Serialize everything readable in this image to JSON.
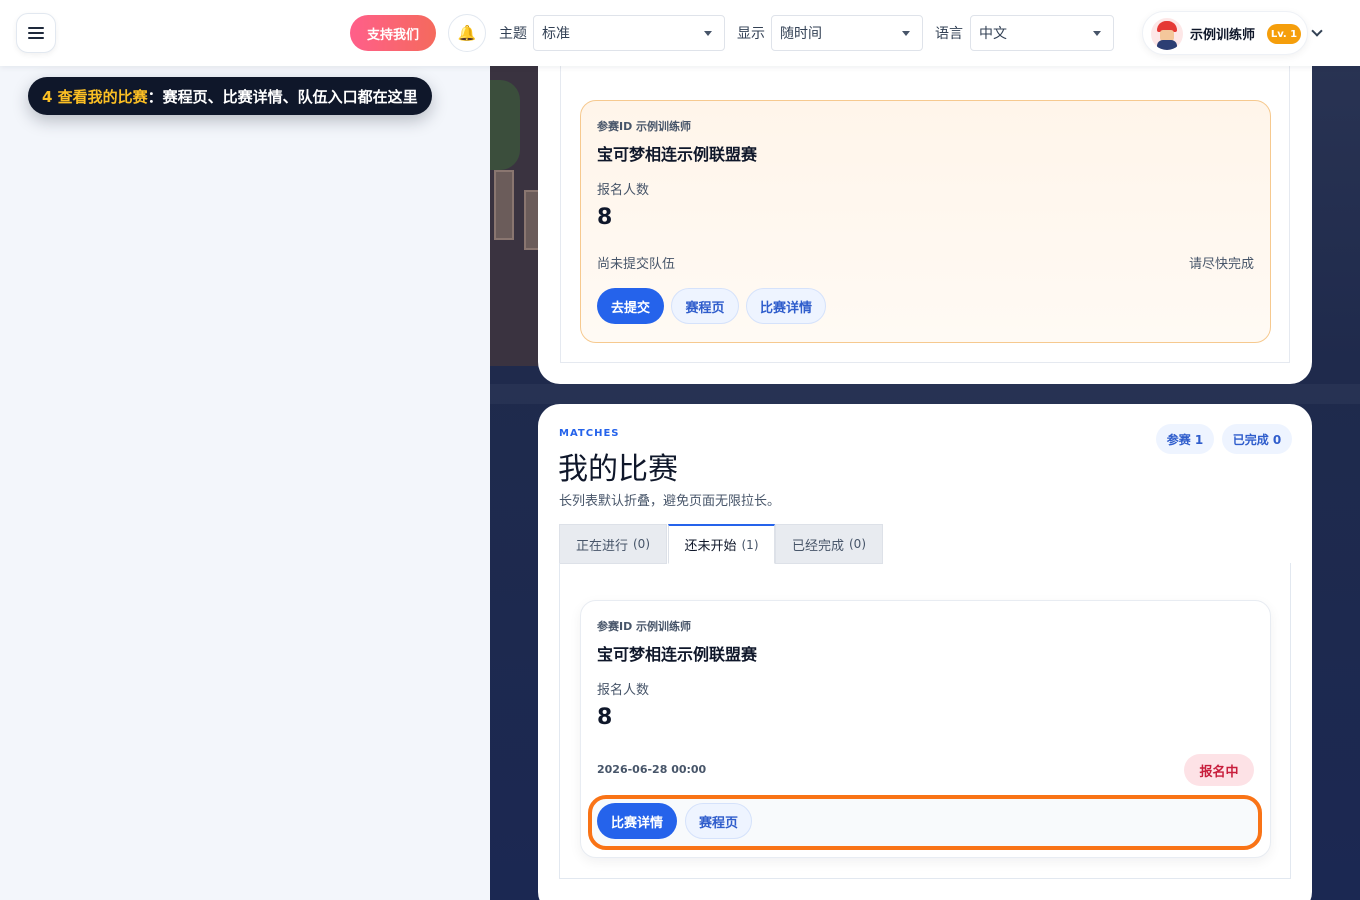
{
  "header": {
    "support_label": "支持我们",
    "theme_label": "主题",
    "theme_value": "标准",
    "display_label": "显示",
    "display_value": "随时间",
    "language_label": "语言",
    "language_value": "中文",
    "user_name": "示例训练师",
    "user_level": "Lv. 1"
  },
  "tutorial": {
    "step_highlight": "4 查看我的比赛",
    "step_text": "：赛程页、比赛详情、队伍入口都在这里"
  },
  "upcoming_card": {
    "entry_id": "参赛ID 示例训练师",
    "title": "宝可梦相连示例联盟赛",
    "count_label": "报名人数",
    "count_value": "8",
    "status_left": "尚未提交队伍",
    "status_right": "请尽快完成",
    "buttons": {
      "submit": "去提交",
      "schedule": "赛程页",
      "details": "比赛详情"
    }
  },
  "matches": {
    "kicker": "MATCHES",
    "title": "我的比赛",
    "description": "长列表默认折叠，避免页面无限拉长。",
    "stats": {
      "joined": "参赛 1",
      "completed": "已完成 0"
    },
    "tabs": [
      {
        "label": "正在进行",
        "count": "(0)"
      },
      {
        "label": "还未开始",
        "count": "(1)"
      },
      {
        "label": "已经完成",
        "count": "(0)"
      }
    ],
    "card": {
      "entry_id": "参赛ID 示例训练师",
      "title": "宝可梦相连示例联盟赛",
      "count_label": "报名人数",
      "count_value": "8",
      "date": "2026-06-28 00:00",
      "status_badge": "报名中",
      "buttons": {
        "details": "比赛详情",
        "schedule": "赛程页"
      }
    }
  },
  "colors": {
    "accent": "#2563eb",
    "highlight": "#f97316",
    "support": "#f56a5d"
  }
}
